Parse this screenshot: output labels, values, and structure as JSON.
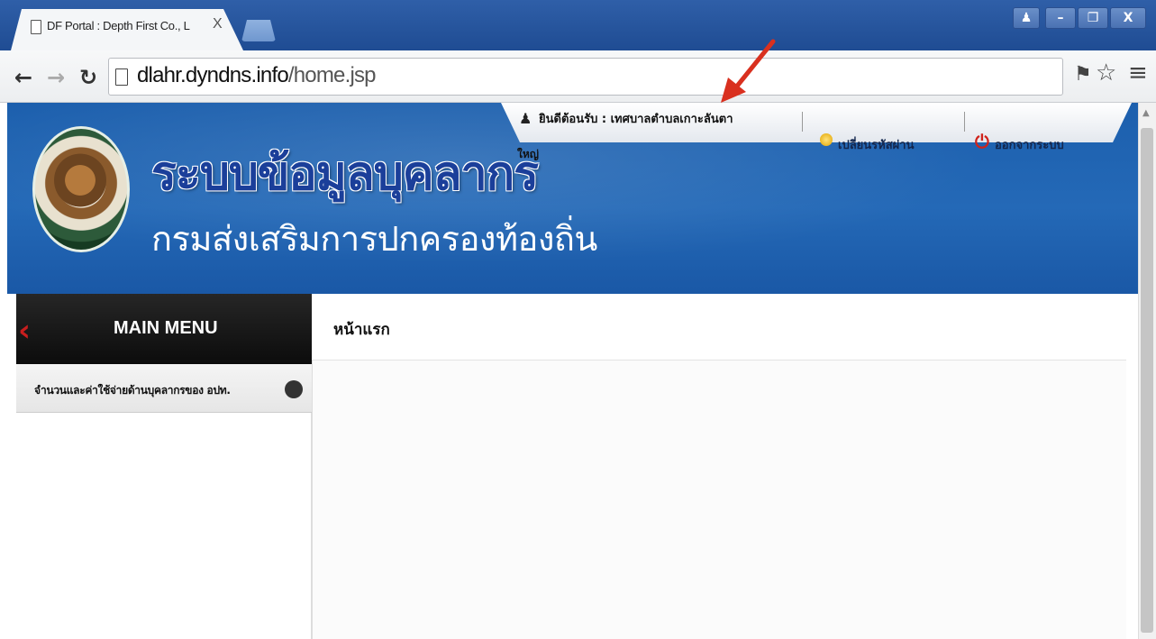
{
  "browser": {
    "tab_title": "DF Portal : Depth First Co., L",
    "tab_close": "X",
    "url_host": "dlahr.dyndns.info",
    "url_path": "/home.jsp",
    "window_buttons": [
      "user-icon",
      "minimize-icon",
      "restore-icon",
      "close-icon"
    ],
    "window_close_label": "X",
    "nav_icons": [
      "back-icon",
      "forward-icon",
      "reload-icon"
    ],
    "toolbar_icons": [
      "key-icon",
      "star-icon",
      "menu-icon"
    ]
  },
  "header": {
    "welcome": "ยินดีต้อนรับ : เทศบาลตำบลเกาะลันตา",
    "welcome_cont": "ใหญ่",
    "change_password": "เปลี่ยนรหัสผ่าน",
    "logout": "ออกจากระบบ",
    "title": "ระบบข้อมูลบุคลากร",
    "subtitle": "กรมส่งเสริมการปกครองท้องถิ่น"
  },
  "sidebar": {
    "menu_title": "MAIN MENU",
    "items": [
      {
        "label": "จำนวนและค่าใช้จ่ายด้านบุคลากรของ อปท."
      }
    ]
  },
  "main": {
    "page_title": "หน้าแรก"
  },
  "colors": {
    "header_blue": "#1c5fad",
    "title_blue": "#1b3f9a",
    "menu_black": "#0c0c0c",
    "accent_red": "#c81e1e",
    "annotation_arrow": "#d9301f"
  }
}
